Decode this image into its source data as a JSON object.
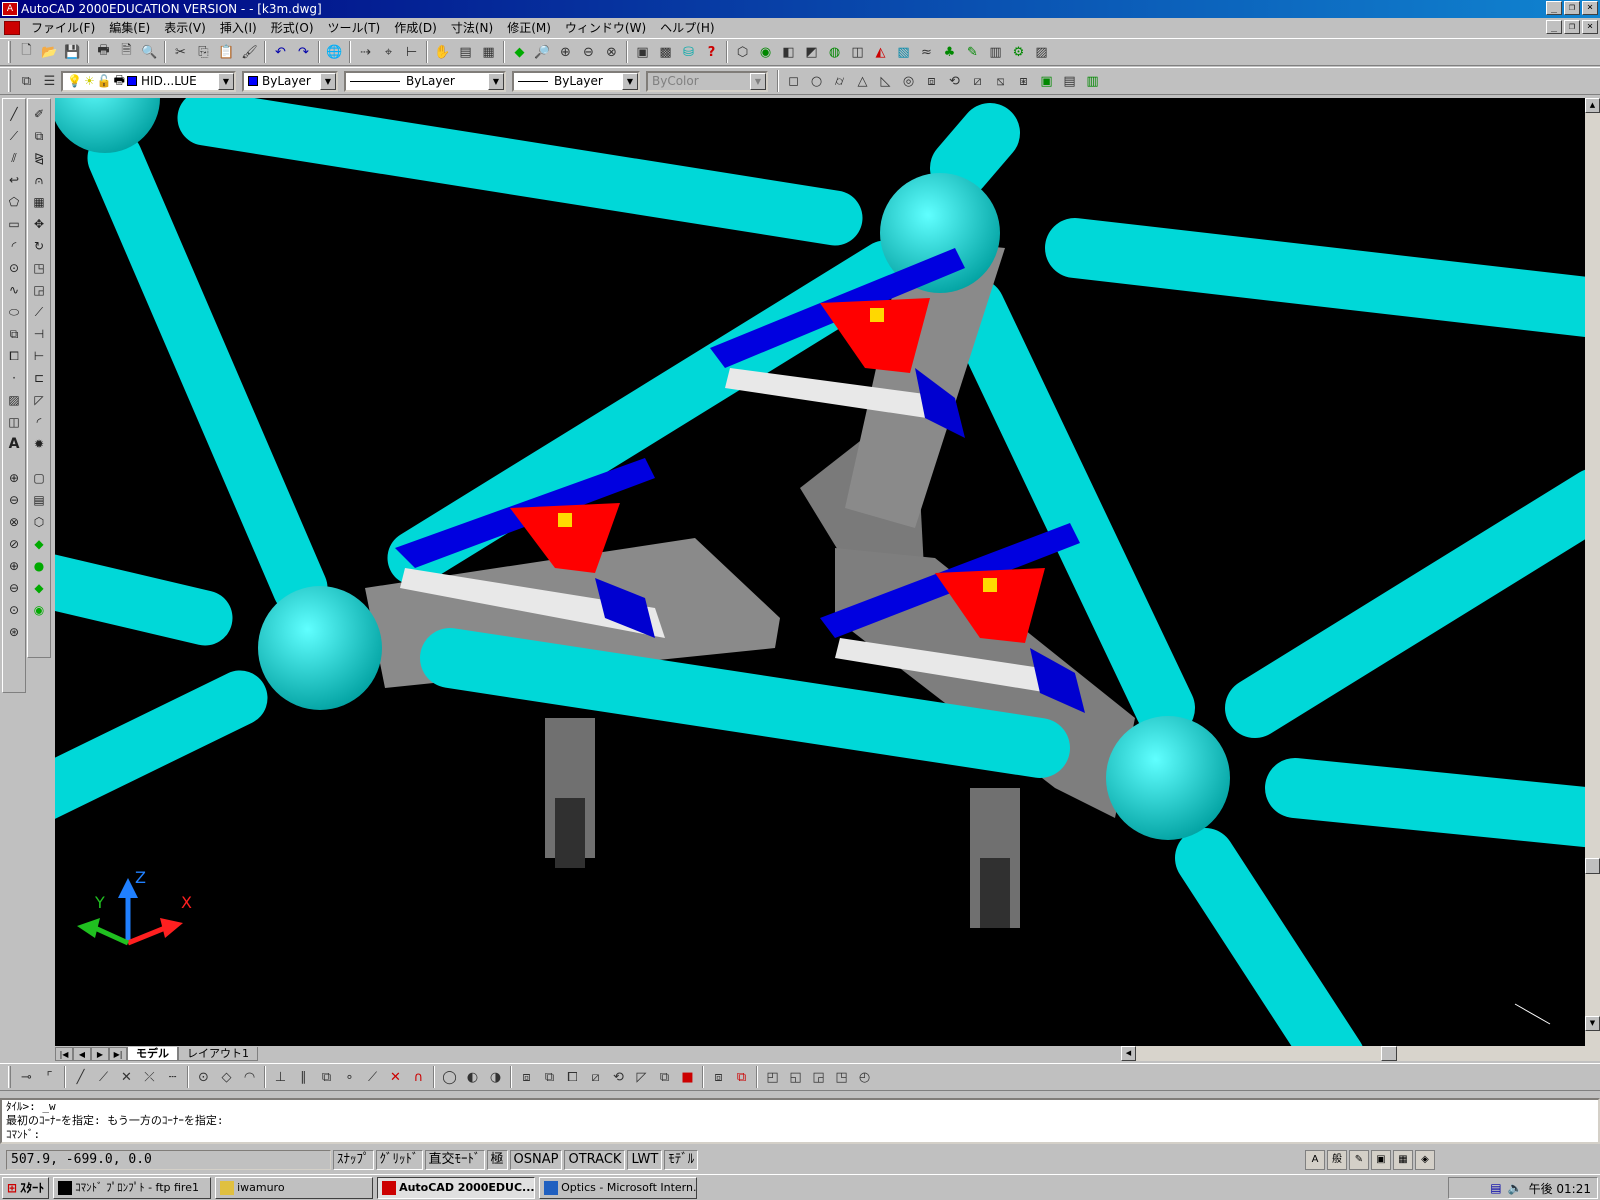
{
  "window": {
    "title": "AutoCAD 2000EDUCATION VERSION - - [k3m.dwg]",
    "controls": [
      "_",
      "❐",
      "×"
    ]
  },
  "menu": {
    "items": [
      "ファイル(F)",
      "編集(E)",
      "表示(V)",
      "挿入(I)",
      "形式(O)",
      "ツール(T)",
      "作成(D)",
      "寸法(N)",
      "修正(M)",
      "ウィンドウ(W)",
      "ヘルプ(H)"
    ]
  },
  "properties": {
    "layer": "HID...LUE",
    "color": "ByLayer",
    "linetype": "ByLayer",
    "lineweight": "ByLayer",
    "plotstyle": "ByColor"
  },
  "ucs": {
    "x": "X",
    "y": "Y",
    "z": "Z"
  },
  "layout": {
    "tabs": [
      "モデル",
      "レイアウト1"
    ]
  },
  "command": {
    "lines": [
      "ﾀｲﾙ>:  _w",
      "最初のｺｰﾅｰを指定: もう一方のｺｰﾅｰを指定:",
      "ｺﾏﾝﾄﾞ:"
    ]
  },
  "status": {
    "coords": "507.9, -699.0, 0.0",
    "toggles": [
      "ｽﾅｯﾌﾟ",
      "ｸﾞﾘｯﾄﾞ",
      "直交ﾓｰﾄﾞ",
      "極",
      "OSNAP",
      "OTRACK",
      "LWT",
      "ﾓﾃﾞﾙ"
    ],
    "tray": [
      "A",
      "般"
    ]
  },
  "taskbar": {
    "start": "ｽﾀｰﾄ",
    "tasks": [
      "ｺﾏﾝﾄﾞ ﾌﾟﾛﾝﾌﾟﾄ - ftp fire1",
      "iwamuro",
      "AutoCAD 2000EDUC...",
      "Optics - Microsoft Intern..."
    ],
    "clock": "午後 01:21"
  },
  "colors": {
    "pipe": "#00e0e0",
    "clamp": "#0000e0",
    "triangle": "#ff0000",
    "block": "#808080"
  }
}
